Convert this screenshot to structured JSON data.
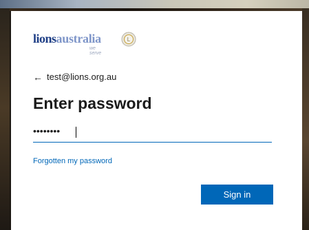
{
  "brand": {
    "name_part1": "lions",
    "name_part2": "australia",
    "tagline": "we serve",
    "colors": {
      "dark_blue": "#1f3f86",
      "light_blue": "#7f96c9",
      "emblem_gold": "#c8a23a"
    }
  },
  "account": {
    "back_icon": "arrow-left-icon",
    "email": "test@lions.org.au"
  },
  "form": {
    "title": "Enter password",
    "password_mask": "••••••••",
    "forgot_link": "Forgotten my password",
    "submit_label": "Sign in"
  },
  "theme": {
    "accent": "#0067b8",
    "text": "#1b1b1b",
    "card_bg": "#ffffff"
  }
}
